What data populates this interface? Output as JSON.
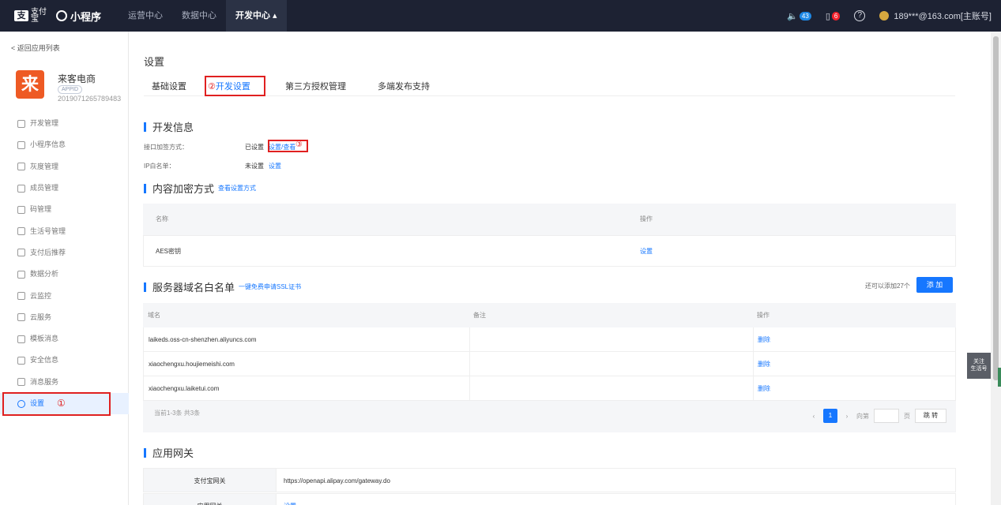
{
  "topbar": {
    "logo_text": "支付宝",
    "logo_sub": "小程序",
    "nav": [
      "运营中心",
      "数据中心",
      "开发中心 ▴"
    ],
    "notif_count": "43",
    "msg_count": "6",
    "account": "189***@163.com[主账号]"
  },
  "sidebar": {
    "back": "< 返回应用列表",
    "app_logo_char": "来",
    "app_name": "来客电商",
    "app_tag": "APPID",
    "app_id": "2019071265789483",
    "items": [
      {
        "label": "开发管理",
        "icon": "code-icon"
      },
      {
        "label": "小程序信息",
        "icon": "grid-icon"
      },
      {
        "label": "灰度管理",
        "icon": "broadcast-icon"
      },
      {
        "label": "成员管理",
        "icon": "user-icon"
      },
      {
        "label": "码管理",
        "icon": "qrcode-icon"
      },
      {
        "label": "生活号管理",
        "icon": "page-icon"
      },
      {
        "label": "支付后推荐",
        "icon": "monitor-icon"
      },
      {
        "label": "数据分析",
        "icon": "clock-icon"
      },
      {
        "label": "云监控",
        "icon": "cloud-icon"
      },
      {
        "label": "云服务",
        "icon": "cloud-icon"
      },
      {
        "label": "模板消息",
        "icon": "message-icon"
      },
      {
        "label": "安全信息",
        "icon": "info-icon"
      },
      {
        "label": "消息服务",
        "icon": "screen-icon"
      },
      {
        "label": "设置",
        "icon": "gear-icon"
      }
    ],
    "anno1": "①"
  },
  "main": {
    "title": "设置",
    "tabs": [
      {
        "label": "基础设置"
      },
      {
        "label": "开发设置",
        "prefix": "②"
      },
      {
        "label": "第三方授权管理"
      },
      {
        "label": "多端发布支持"
      }
    ],
    "dev_info": {
      "title": "开发信息",
      "rows": [
        {
          "key": "接口加签方式：",
          "status": "已设置",
          "link": "设置/查看"
        },
        {
          "key": "IP白名单：",
          "status": "未设置",
          "link": "设置"
        }
      ],
      "anno3": "③"
    },
    "encrypt": {
      "title": "内容加密方式",
      "link": "查看设置方式",
      "headers": [
        "名称",
        "操作"
      ],
      "rows": [
        {
          "name": "AES密钥",
          "op": "设置"
        }
      ]
    },
    "domains": {
      "title": "服务器域名白名单",
      "link": "一键免费申请SSL证书",
      "hint": "还可以添加27个",
      "add": "添 加",
      "headers": [
        "域名",
        "备注",
        "操作"
      ],
      "rows": [
        {
          "domain": "laikeds.oss-cn-shenzhen.aliyuncs.com",
          "note": "",
          "op": "删除"
        },
        {
          "domain": "xiaochengxu.houjiemeishi.com",
          "note": "",
          "op": "删除"
        },
        {
          "domain": "xiaochengxu.laiketui.com",
          "note": "",
          "op": "删除"
        }
      ],
      "total": "当前1-3条 共3条",
      "page": "1",
      "goto": "向第",
      "page_unit": "页",
      "jump": "跳 转"
    },
    "gateway": {
      "title": "应用网关",
      "rows": [
        {
          "label": "支付宝网关",
          "value": "https://openapi.alipay.com/gateway.do"
        },
        {
          "label": "应用网关",
          "value": "设置"
        }
      ]
    }
  },
  "float": {
    "follow": "关注\n生活号"
  }
}
